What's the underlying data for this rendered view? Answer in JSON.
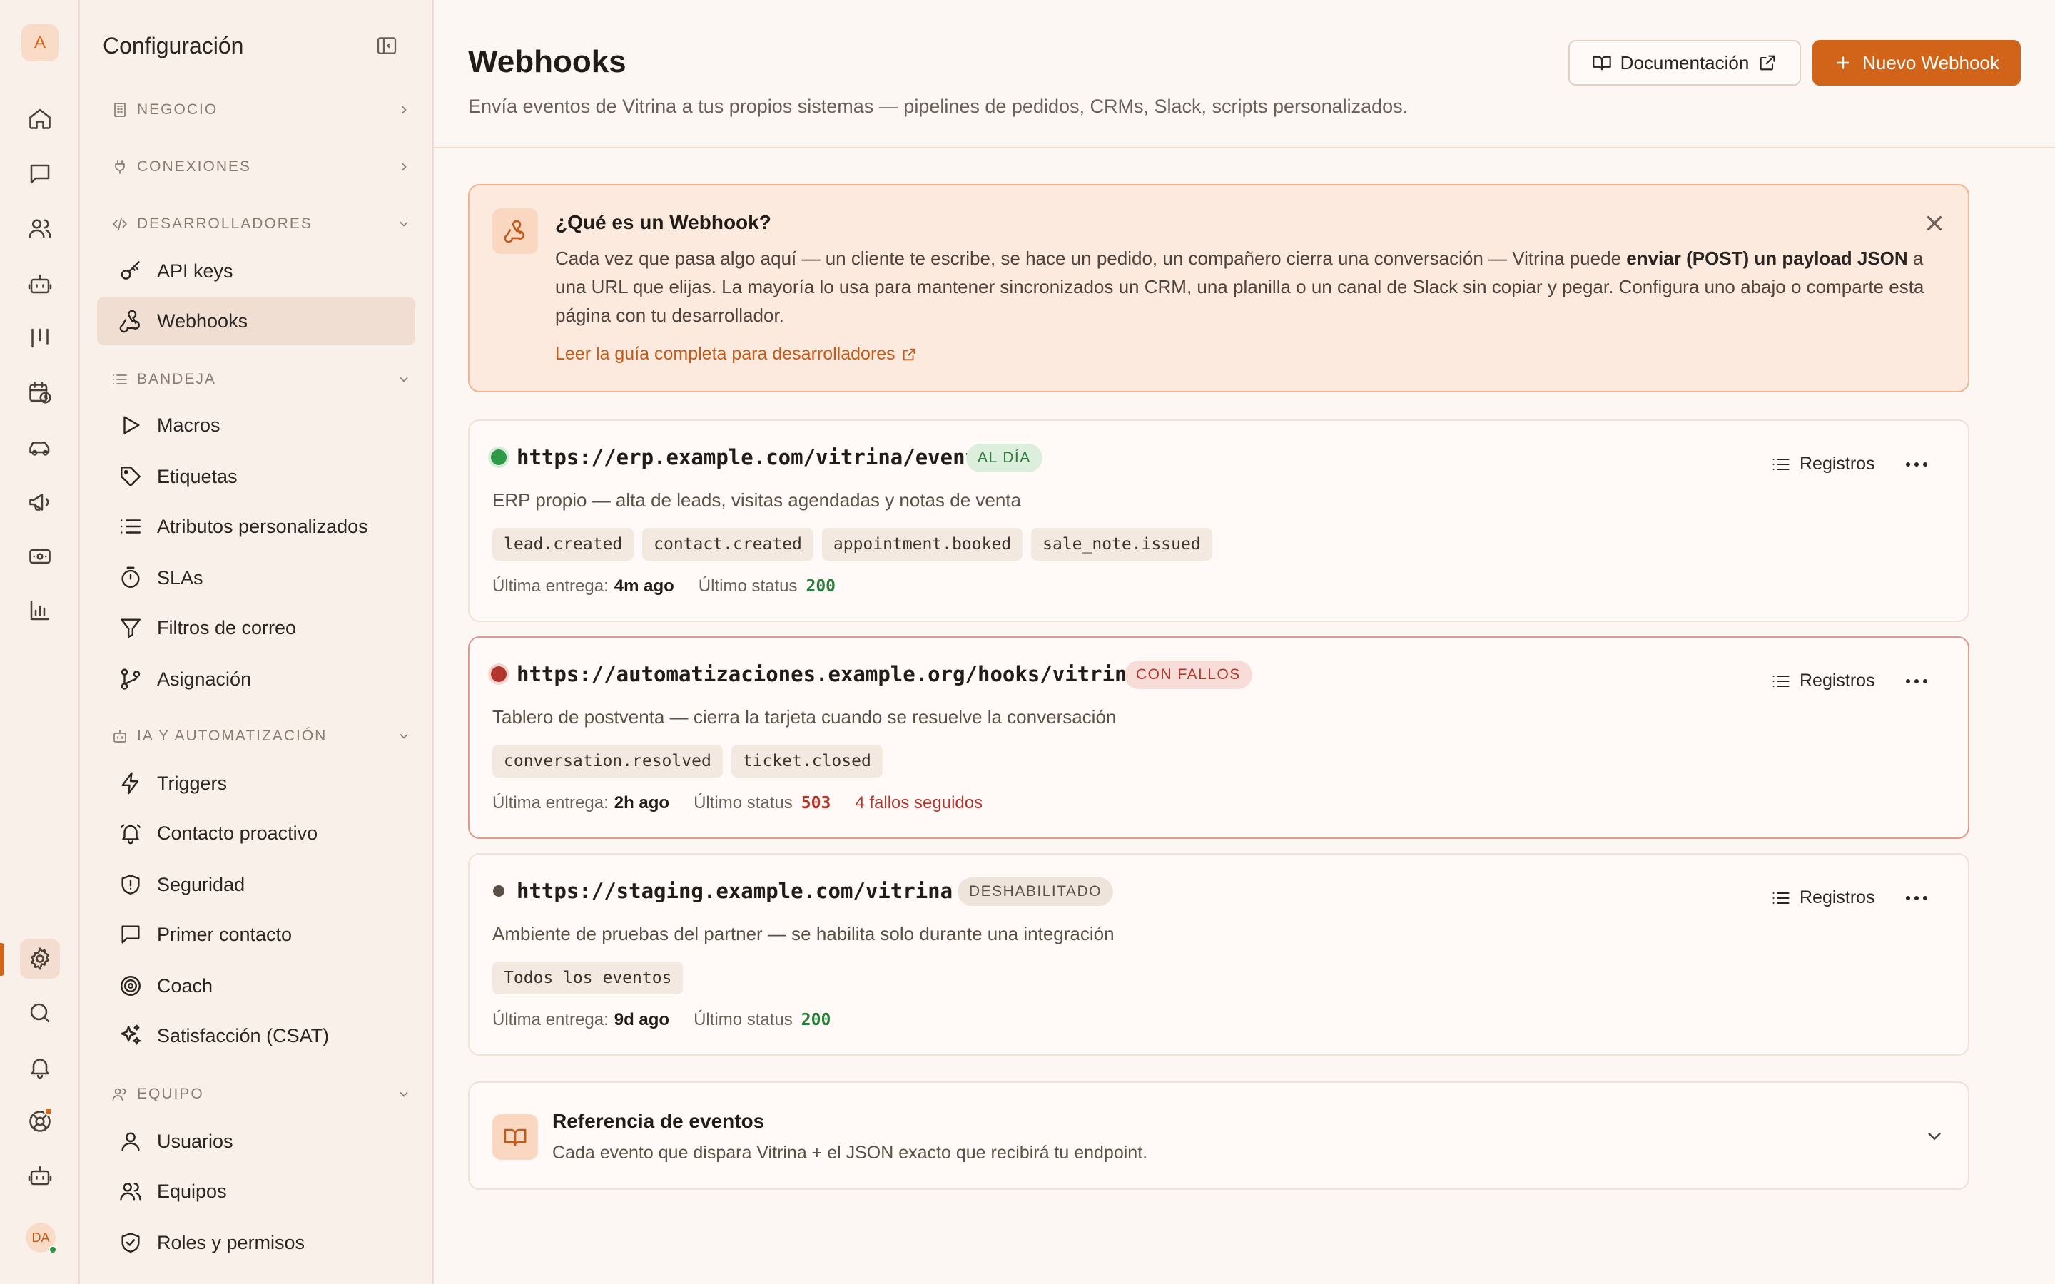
{
  "rail": {
    "avatar_letter": "A",
    "user_initials": "DA"
  },
  "sidebar": {
    "title": "Configuración",
    "sections": {
      "negocio": "NEGOCIO",
      "conexiones": "CONEXIONES",
      "desarrolladores": "DESARROLLADORES",
      "bandeja": "BANDEJA",
      "ia": "IA Y AUTOMATIZACIÓN",
      "equipo": "EQUIPO"
    },
    "items": {
      "api_keys": "API keys",
      "webhooks": "Webhooks",
      "macros": "Macros",
      "etiquetas": "Etiquetas",
      "atributos": "Atributos personalizados",
      "slas": "SLAs",
      "filtros": "Filtros de correo",
      "asignacion": "Asignación",
      "triggers": "Triggers",
      "contacto_proactivo": "Contacto proactivo",
      "seguridad": "Seguridad",
      "primer_contacto": "Primer contacto",
      "coach": "Coach",
      "satisfaccion": "Satisfacción (CSAT)",
      "usuarios": "Usuarios",
      "equipos": "Equipos",
      "roles": "Roles y permisos"
    }
  },
  "header": {
    "title": "Webhooks",
    "subtitle": "Envía eventos de Vitrina a tus propios sistemas — pipelines de pedidos, CRMs, Slack, scripts personalizados.",
    "doc_button": "Documentación",
    "new_button": "Nuevo Webhook"
  },
  "info": {
    "title": "¿Qué es un Webhook?",
    "body_pre": "Cada vez que pasa algo aquí — un cliente te escribe, se hace un pedido, un compañero cierra una conversación — Vitrina puede ",
    "body_bold": "enviar (POST) un payload JSON",
    "body_post": " a una URL que elijas. La mayoría lo usa para mantener sincronizados un CRM, una planilla o un canal de Slack sin copiar y pegar. Configura uno abajo o comparte esta página con tu desarrollador.",
    "link": "Leer la guía completa para desarrolladores"
  },
  "labels": {
    "last_delivery": "Última entrega:",
    "last_status": "Último status",
    "logs": "Registros"
  },
  "webhooks": [
    {
      "url": "https://erp.example.com/vitrina/eventos",
      "badge": "AL DÍA",
      "description": "ERP propio — alta de leads, visitas agendadas y notas de venta",
      "events": [
        "lead.created",
        "contact.created",
        "appointment.booked",
        "sale_note.issued"
      ],
      "last_delivery": "4m ago",
      "last_status": "200",
      "failures": ""
    },
    {
      "url": "https://automatizaciones.example.org/hooks/vitrina",
      "badge": "CON FALLOS",
      "description": "Tablero de postventa — cierra la tarjeta cuando se resuelve la conversación",
      "events": [
        "conversation.resolved",
        "ticket.closed"
      ],
      "last_delivery": "2h ago",
      "last_status": "503",
      "failures": "4 fallos seguidos"
    },
    {
      "url": "https://staging.example.com/vitrina",
      "badge": "DESHABILITADO",
      "description": "Ambiente de pruebas del partner — se habilita solo durante una integración",
      "events": [
        "Todos los eventos"
      ],
      "last_delivery": "9d ago",
      "last_status": "200",
      "failures": ""
    }
  ],
  "reference": {
    "title": "Referencia de eventos",
    "subtitle": "Cada evento que dispara Vitrina + el JSON exacto que recibirá tu endpoint."
  },
  "colors": {
    "accent": "#d2641a",
    "ok": "#2e7d3e",
    "fail": "#b3362c",
    "disabled": "#5b5048"
  }
}
